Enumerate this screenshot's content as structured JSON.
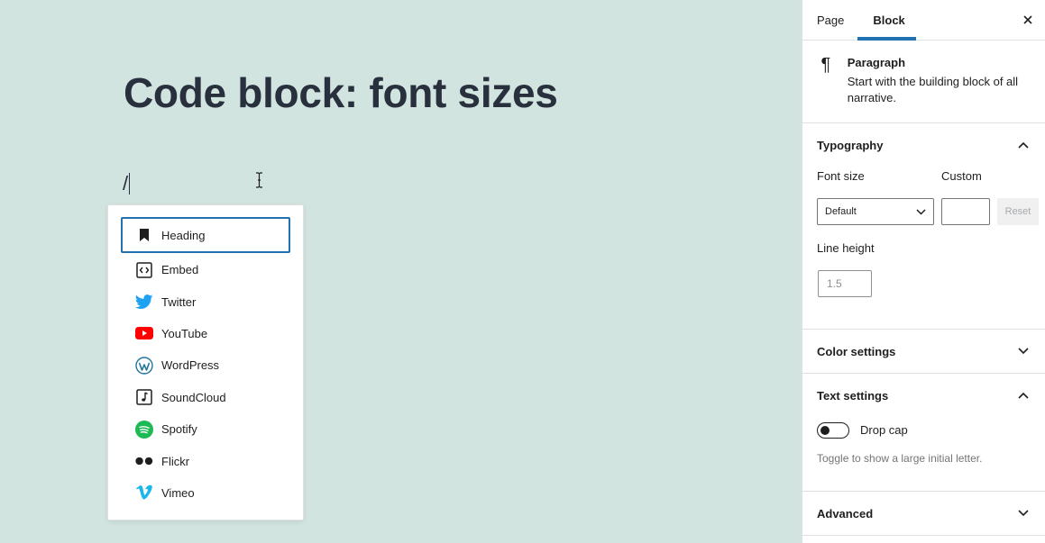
{
  "editor": {
    "title": "Code block: font sizes",
    "slash_text": "/"
  },
  "inserter": {
    "items": [
      {
        "label": "Heading",
        "icon": "bookmark-icon",
        "selected": true
      },
      {
        "label": "Embed",
        "icon": "embed-icon"
      },
      {
        "label": "Twitter",
        "icon": "twitter-icon"
      },
      {
        "label": "YouTube",
        "icon": "youtube-icon"
      },
      {
        "label": "WordPress",
        "icon": "wordpress-icon"
      },
      {
        "label": "SoundCloud",
        "icon": "soundcloud-icon"
      },
      {
        "label": "Spotify",
        "icon": "spotify-icon"
      },
      {
        "label": "Flickr",
        "icon": "flickr-icon"
      },
      {
        "label": "Vimeo",
        "icon": "vimeo-icon"
      }
    ]
  },
  "sidebar": {
    "tabs": [
      "Page",
      "Block"
    ],
    "active_tab": "Block",
    "block": {
      "name": "Paragraph",
      "description": "Start with the building block of all narrative.",
      "icon": "paragraph-icon"
    },
    "typography": {
      "heading": "Typography",
      "font_size_label": "Font size",
      "custom_label": "Custom",
      "font_size_value": "Default",
      "reset_label": "Reset",
      "line_height_label": "Line height",
      "line_height_placeholder": "1.5"
    },
    "color_settings": {
      "heading": "Color settings"
    },
    "text_settings": {
      "heading": "Text settings",
      "drop_cap_label": "Drop cap",
      "drop_cap_help": "Toggle to show a large initial letter.",
      "drop_cap_on": false
    },
    "advanced": {
      "heading": "Advanced"
    }
  },
  "colors": {
    "canvas_bg": "#d2e4df",
    "accent": "#2271b1",
    "twitter": "#1da1f2",
    "youtube": "#ff0000",
    "wordpress": "#21759b",
    "spotify": "#1db954",
    "vimeo": "#1ab7ea"
  }
}
